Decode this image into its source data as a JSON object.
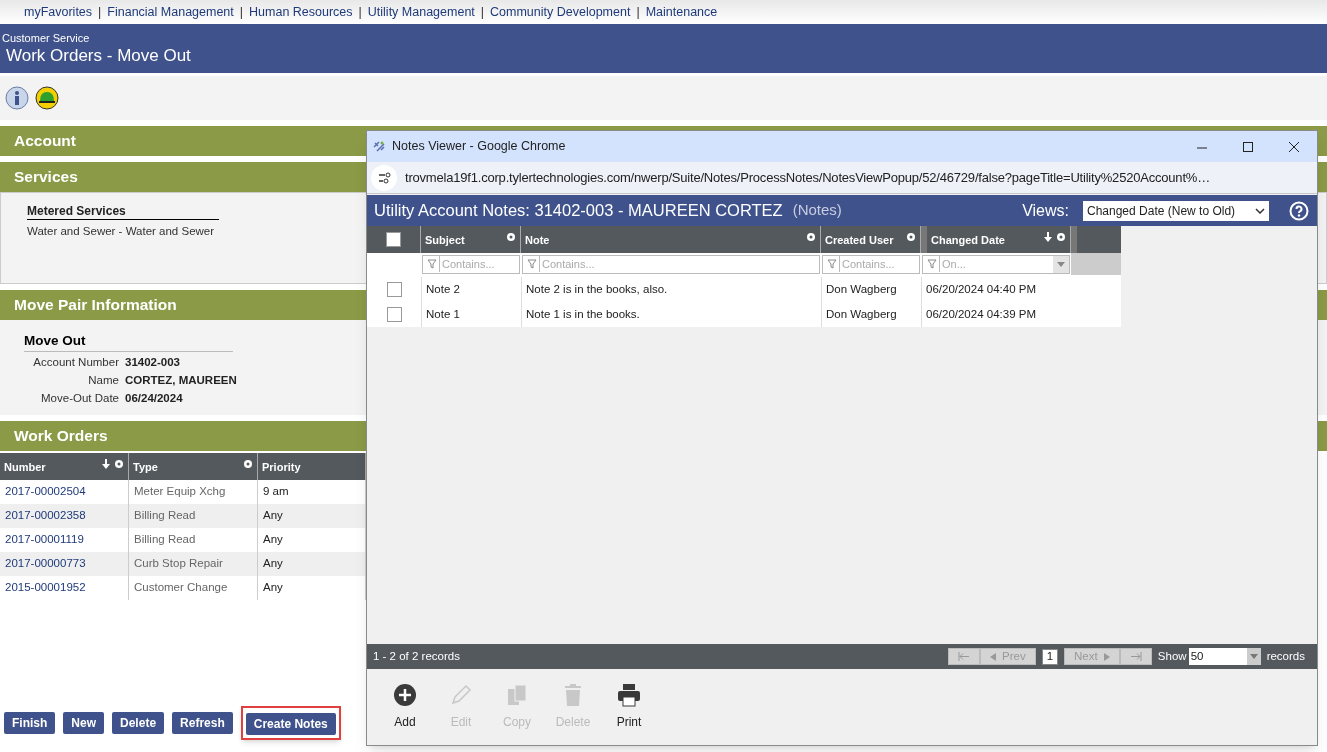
{
  "top_nav": {
    "links": [
      "myFavorites",
      "Financial Management",
      "Human Resources",
      "Utility Management",
      "Community Development",
      "Maintenance"
    ],
    "separators": [
      "|",
      "|",
      "|",
      "|",
      "|"
    ]
  },
  "header": {
    "module": "Customer Service",
    "title": "Work Orders - Move Out"
  },
  "sections": [
    {
      "kind": "collapsed",
      "title": "Account"
    },
    {
      "kind": "services",
      "title": "Services",
      "heading": "Metered Services",
      "lines": [
        "Water and Sewer - Water and Sewer"
      ]
    },
    {
      "kind": "fields",
      "title": "Move Pair Information",
      "heading": "Move Out",
      "fields": [
        {
          "label": "Account Number",
          "value": "31402-003"
        },
        {
          "label": "Name",
          "value": "CORTEZ, MAUREEN"
        },
        {
          "label": "Move-Out Date",
          "value": "06/24/2024"
        }
      ]
    },
    {
      "kind": "table",
      "title": "Work Orders",
      "columns": [
        {
          "label": "Number",
          "sorted": true
        },
        {
          "label": "Type",
          "sorted": false
        },
        {
          "label": "Priority",
          "sorted": false
        }
      ],
      "rows": [
        [
          "2017-00002504",
          "Meter Equip Xchg",
          "9 am"
        ],
        [
          "2017-00002358",
          "Billing Read",
          "Any"
        ],
        [
          "2017-00001119",
          "Billing Read",
          "Any"
        ],
        [
          "2017-00000773",
          "Curb Stop Repair",
          "Any"
        ],
        [
          "2015-00001952",
          "Customer Change",
          "Any"
        ]
      ]
    }
  ],
  "buttons": [
    {
      "label": "Finish",
      "highlighted": false
    },
    {
      "label": "New",
      "highlighted": false
    },
    {
      "label": "Delete",
      "highlighted": false
    },
    {
      "label": "Refresh",
      "highlighted": false
    },
    {
      "label": "Create Notes",
      "highlighted": true
    }
  ],
  "popup": {
    "window_title": "Notes Viewer - Google Chrome",
    "url": "trovmela19f1.corp.tylertechnologies.com/nwerp/Suite/Notes/ProcessNotes/NotesViewPopup/52/46729/false?pageTitle=Utility%2520Account%…",
    "title": "Utility Account Notes: 31402-003 - MAUREEN CORTEZ",
    "subtitle": "(Notes)",
    "views_label": "Views:",
    "views_value": "Changed Date (New to Old)",
    "columns": [
      {
        "label": "Subject",
        "filter": "Contains...",
        "sorted": false
      },
      {
        "label": "Note",
        "filter": "Contains...",
        "sorted": false
      },
      {
        "label": "Created User",
        "filter": "Contains...",
        "sorted": false
      },
      {
        "label": "Changed Date",
        "filter": "On...",
        "sorted": true
      }
    ],
    "rows": [
      {
        "checked": false,
        "cells": [
          "Note 2",
          "Note 2 is in the books, also.",
          "Don Wagberg",
          "06/20/2024 04:40 PM"
        ]
      },
      {
        "checked": false,
        "cells": [
          "Note 1",
          "Note 1 is in the books.",
          "Don Wagberg",
          "06/20/2024 04:39 PM"
        ]
      }
    ],
    "all_checked": false,
    "pager": {
      "summary": "1 - 2 of 2 records",
      "prev": "Prev",
      "page": "1",
      "next": "Next",
      "show": "Show",
      "size": "50",
      "suffix": "records"
    },
    "actions": [
      {
        "kind": "add",
        "label": "Add",
        "disabled": false
      },
      {
        "kind": "edit",
        "label": "Edit",
        "disabled": true
      },
      {
        "kind": "copy",
        "label": "Copy",
        "disabled": true
      },
      {
        "kind": "delete",
        "label": "Delete",
        "disabled": true
      },
      {
        "kind": "print",
        "label": "Print",
        "disabled": false
      }
    ]
  }
}
